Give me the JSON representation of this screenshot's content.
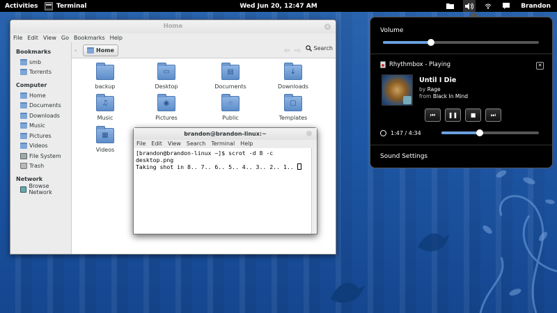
{
  "topbar": {
    "activities": "Activities",
    "app_name": "Terminal",
    "clock": "Wed Jun 20, 12:47 AM",
    "user": "Brandon"
  },
  "nautilus": {
    "title": "Home",
    "menu": [
      "File",
      "Edit",
      "View",
      "Go",
      "Bookmarks",
      "Help"
    ],
    "location": "Home",
    "search": "Search",
    "sidebar": {
      "bookmarks_heading": "Bookmarks",
      "bookmarks": [
        "smb",
        "Torrents"
      ],
      "computer_heading": "Computer",
      "computer": [
        "Home",
        "Documents",
        "Downloads",
        "Music",
        "Pictures",
        "Videos",
        "File System",
        "Trash"
      ],
      "network_heading": "Network",
      "network": [
        "Browse Network"
      ]
    },
    "folders": [
      {
        "name": "backup",
        "icon": "folder-icon"
      },
      {
        "name": "Desktop",
        "icon": "desktop-folder-icon"
      },
      {
        "name": "Documents",
        "icon": "documents-folder-icon"
      },
      {
        "name": "Downloads",
        "icon": "downloads-folder-icon"
      },
      {
        "name": "Music",
        "icon": "music-folder-icon"
      },
      {
        "name": "Pictures",
        "icon": "pictures-folder-icon"
      },
      {
        "name": "Public",
        "icon": "public-folder-icon"
      },
      {
        "name": "Templates",
        "icon": "templates-folder-icon"
      },
      {
        "name": "Videos",
        "icon": "videos-folder-icon"
      }
    ]
  },
  "terminal": {
    "title": "brandon@brandon-linux:~",
    "menu": [
      "File",
      "Edit",
      "View",
      "Search",
      "Terminal",
      "Help"
    ],
    "lines": [
      "[brandon@brandon-linux ~]$ scrot -d 8 -c desktop.png",
      "Taking shot in 8.. 7.. 6.. 5.. 4.. 3.. 2.. 1.."
    ]
  },
  "sound_popup": {
    "volume_label": "Volume",
    "volume_level": 0.31,
    "player_header": "Rhythmbox - Playing",
    "track": "Until I Die",
    "by_prefix": "by",
    "artist": "Rage",
    "from_prefix": "from",
    "album": "Black In Mind",
    "position": "1:47 / 4:34",
    "progress": 0.39,
    "settings_label": "Sound Settings"
  },
  "colors": {
    "accent": "#6aa0e0",
    "wallpaper": "#1e58a6",
    "topbar": "#000000"
  }
}
